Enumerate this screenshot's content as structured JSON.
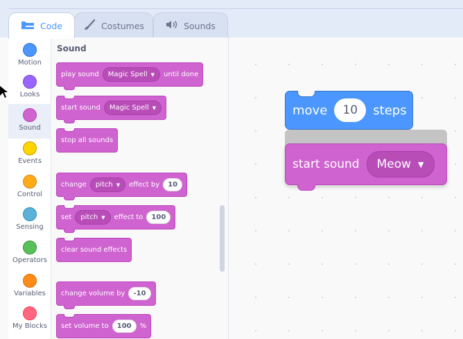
{
  "tabs": [
    {
      "label": "Code",
      "icon": "code-icon",
      "active": true
    },
    {
      "label": "Costumes",
      "icon": "brush-icon",
      "active": false
    },
    {
      "label": "Sounds",
      "icon": "speaker-icon",
      "active": false
    }
  ],
  "categories": [
    {
      "label": "Motion",
      "color": "#4c97ff"
    },
    {
      "label": "Looks",
      "color": "#9966ff"
    },
    {
      "label": "Sound",
      "color": "#cf63cf",
      "active": true
    },
    {
      "label": "Events",
      "color": "#ffd500"
    },
    {
      "label": "Control",
      "color": "#ffab19"
    },
    {
      "label": "Sensing",
      "color": "#5cb1d6"
    },
    {
      "label": "Operators",
      "color": "#59c059"
    },
    {
      "label": "Variables",
      "color": "#ff8c1a"
    },
    {
      "label": "My Blocks",
      "color": "#ff6680"
    }
  ],
  "palette": {
    "heading": "Sound",
    "blocks": {
      "play_sound": {
        "before": "play sound",
        "menu": "Magic Spell",
        "after": "until done"
      },
      "start_sound": {
        "before": "start sound",
        "menu": "Magic Spell"
      },
      "stop_all": {
        "text": "stop all sounds"
      },
      "change_effect": {
        "before": "change",
        "menu": "pitch",
        "middle": "effect by",
        "value": "10"
      },
      "set_effect": {
        "before": "set",
        "menu": "pitch",
        "middle": "effect to",
        "value": "100"
      },
      "clear_effects": {
        "text": "clear sound effects"
      },
      "change_volume": {
        "before": "change volume by",
        "value": "-10"
      },
      "set_volume": {
        "before": "set volume to",
        "value": "100",
        "after": "%"
      }
    }
  },
  "script": {
    "move_block": {
      "before": "move",
      "value": "10",
      "after": "steps"
    },
    "start_sound_block": {
      "before": "start sound",
      "menu": "Meow"
    }
  },
  "colors": {
    "motion": "#4c97ff",
    "sound": "#cf63cf",
    "tab_active_text": "#4c97ff"
  }
}
